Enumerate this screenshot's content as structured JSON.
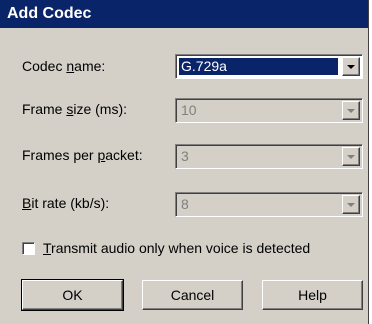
{
  "window": {
    "title": "Add Codec"
  },
  "fields": [
    {
      "label_pre": "Codec ",
      "label_key": "n",
      "label_post": "ame:",
      "value": "G.729a",
      "enabled": true
    },
    {
      "label_pre": "Frame ",
      "label_key": "s",
      "label_post": "ize (ms):",
      "value": "10",
      "enabled": false
    },
    {
      "label_pre": "Frames per ",
      "label_key": "p",
      "label_post": "acket:",
      "value": "3",
      "enabled": false
    },
    {
      "label_pre": "",
      "label_key": "B",
      "label_post": "it rate (kb/s):",
      "value": "8",
      "enabled": false
    }
  ],
  "checkbox": {
    "label_key": "T",
    "label_post": "ransmit audio only when voice is detected",
    "checked": false
  },
  "buttons": {
    "ok": "OK",
    "cancel": "Cancel",
    "help": "Help"
  },
  "icons": {
    "dropdown": "chevron-down-icon"
  },
  "colors": {
    "titlebar": "#0a246a",
    "face": "#d4d0c8",
    "selection": "#0a246a",
    "disabled_text": "#808080"
  }
}
